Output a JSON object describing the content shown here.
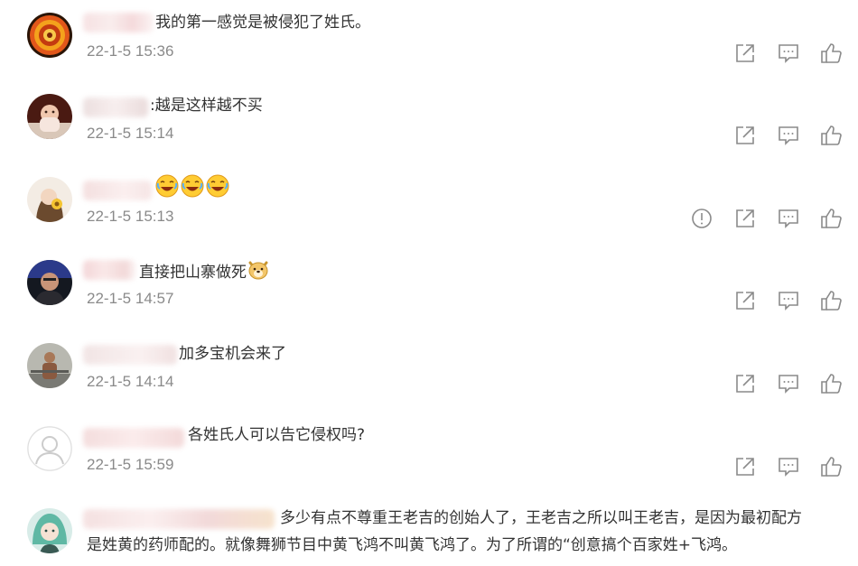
{
  "comments": [
    {
      "text": "我的第一感觉是被侵犯了姓氏。",
      "time": "22-1-5 15:36"
    },
    {
      "text": ":越是这样越不买",
      "time": "22-1-5 15:14"
    },
    {
      "text": "",
      "time": "22-1-5 15:13",
      "emojis": [
        "laugh-cry-emoji",
        "laugh-cry-emoji",
        "laugh-cry-emoji"
      ]
    },
    {
      "text": "直接把山寨做死",
      "time": "22-1-5 14:57",
      "emojis": [
        "doge-emoji"
      ]
    },
    {
      "text": "加多宝机会来了",
      "time": "22-1-5 14:14"
    },
    {
      "text": "各姓氏人可以告它侵权吗?",
      "time": "22-1-5 15:59"
    },
    {
      "text_line1": "多少有点不尊重王老吉的创始人了，王老吉之所以叫王老吉，是因为最初配方",
      "text_line2": "是姓黄的药师配的。就像舞狮节目中黄飞鸿不叫黄飞鸿了。为了所谓的“创意搞个百家姓+飞鸿。"
    }
  ],
  "icons": {
    "share": "share-icon",
    "reply": "comment-icon",
    "like": "thumbs-up-icon",
    "report": "report-icon"
  },
  "colors": {
    "text": "#333333",
    "time": "#8a8a8a",
    "icon": "#8a8a8a"
  }
}
